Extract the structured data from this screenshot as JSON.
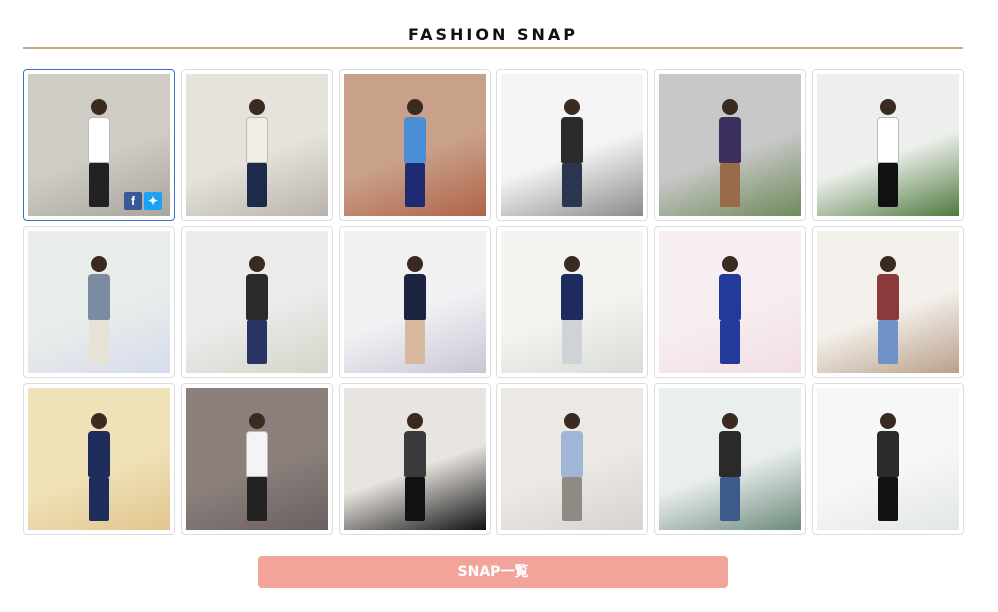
{
  "section": {
    "title": "FASHION SNAP"
  },
  "snaps": [
    {
      "bg": "#a8a49e",
      "wall": "#cfcbc5",
      "top": "#ffffff",
      "bottom": "#222222",
      "selected": true
    },
    {
      "bg": "#b8b3ad",
      "wall": "#e6e2dc",
      "top": "#f4ede4",
      "bottom": "#1e2a4a"
    },
    {
      "bg": "#b06448",
      "wall": "#c9a08a",
      "top": "#4a8fd6",
      "bottom": "#1e2a72"
    },
    {
      "bg": "#8b8b8b",
      "wall": "#f4f4f4",
      "top": "#2b2b2b",
      "bottom": "#2a3550"
    },
    {
      "bg": "#6f8a5a",
      "wall": "#c8c8c8",
      "top": "#3d2f5e",
      "bottom": "#9a6b4a"
    },
    {
      "bg": "#4f7a3e",
      "wall": "#eef0ee",
      "top": "#ffffff",
      "bottom": "#111111"
    },
    {
      "bg": "#d6dbee",
      "wall": "#e9ede9",
      "top": "#7b8ba0",
      "bottom": "#e6e2d6"
    },
    {
      "bg": "#d2d6c8",
      "wall": "#ebebeb",
      "top": "#2a2a2a",
      "bottom": "#283562"
    },
    {
      "bg": "#c9c6d4",
      "wall": "#f1f1f4",
      "top": "#1d2440",
      "bottom": "#d8b9a0"
    },
    {
      "bg": "#d9dcd5",
      "wall": "#f3f3f0",
      "top": "#1e2b5e",
      "bottom": "#cfd3d8"
    },
    {
      "bg": "#f2dde6",
      "wall": "#f6eef0",
      "top": "#223a9a",
      "bottom": "#223a9a"
    },
    {
      "bg": "#b9a08a",
      "wall": "#f4f1ec",
      "top": "#8a3a3a",
      "bottom": "#6f92c8"
    },
    {
      "bg": "#e1c58f",
      "wall": "#f0e2b8",
      "top": "#1e2d5c",
      "bottom": "#1e2d5c"
    },
    {
      "bg": "#6b6060",
      "wall": "#8b807c",
      "top": "#f4f4f4",
      "bottom": "#222222"
    },
    {
      "bg": "#111111",
      "wall": "#e8e4df",
      "top": "#3b3b3b",
      "bottom": "#111111"
    },
    {
      "bg": "#d6d3cf",
      "wall": "#ece9e5",
      "top": "#9fb6d8",
      "bottom": "#8f8a83"
    },
    {
      "bg": "#6d8a7a",
      "wall": "#e9eeee",
      "top": "#2a2a2a",
      "bottom": "#3d5a8a"
    },
    {
      "bg": "#e2e6e4",
      "wall": "#f6f8f7",
      "top": "#2b2b2b",
      "bottom": "#111111"
    }
  ],
  "icons": {
    "facebook": "facebook-icon",
    "twitter": "twitter-icon"
  },
  "cta": {
    "label": "SNAP一覧"
  },
  "colors": {
    "rule": "#c7a783",
    "cta_bg": "#f2a39a",
    "selected_border": "#3b73c4"
  }
}
